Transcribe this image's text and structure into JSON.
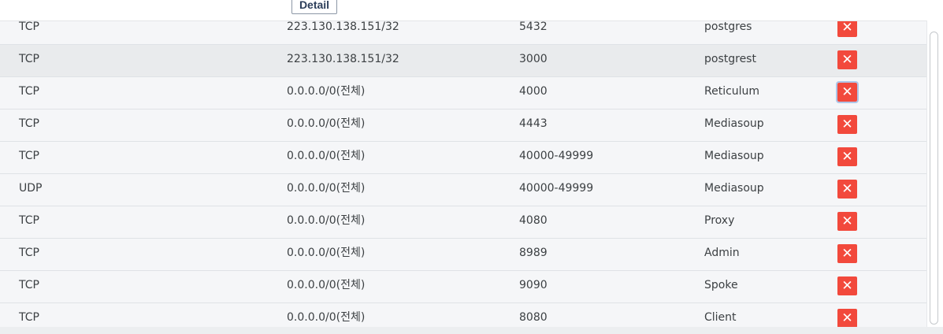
{
  "detail_label": "Detail",
  "delete_glyph": "✕",
  "rows": [
    {
      "protocol": "TCP",
      "source": "223.130.138.151/32",
      "port": "5432",
      "description": "postgres"
    },
    {
      "protocol": "TCP",
      "source": "223.130.138.151/32",
      "port": "3000",
      "description": "postgrest"
    },
    {
      "protocol": "TCP",
      "source": "0.0.0.0/0(전체)",
      "port": "4000",
      "description": "Reticulum"
    },
    {
      "protocol": "TCP",
      "source": "0.0.0.0/0(전체)",
      "port": "4443",
      "description": "Mediasoup"
    },
    {
      "protocol": "TCP",
      "source": "0.0.0.0/0(전체)",
      "port": "40000-49999",
      "description": "Mediasoup"
    },
    {
      "protocol": "UDP",
      "source": "0.0.0.0/0(전체)",
      "port": "40000-49999",
      "description": "Mediasoup"
    },
    {
      "protocol": "TCP",
      "source": "0.0.0.0/0(전체)",
      "port": "4080",
      "description": "Proxy"
    },
    {
      "protocol": "TCP",
      "source": "0.0.0.0/0(전체)",
      "port": "8989",
      "description": "Admin"
    },
    {
      "protocol": "TCP",
      "source": "0.0.0.0/0(전체)",
      "port": "9090",
      "description": "Spoke"
    },
    {
      "protocol": "TCP",
      "source": "0.0.0.0/0(전체)",
      "port": "8080",
      "description": "Client"
    }
  ],
  "colors": {
    "delete_button": "#f2493c",
    "row_background": "#f5f6f8",
    "row_hover_background": "#e9ebed",
    "text": "#3c4043",
    "detail_text": "#2c3e5a"
  }
}
